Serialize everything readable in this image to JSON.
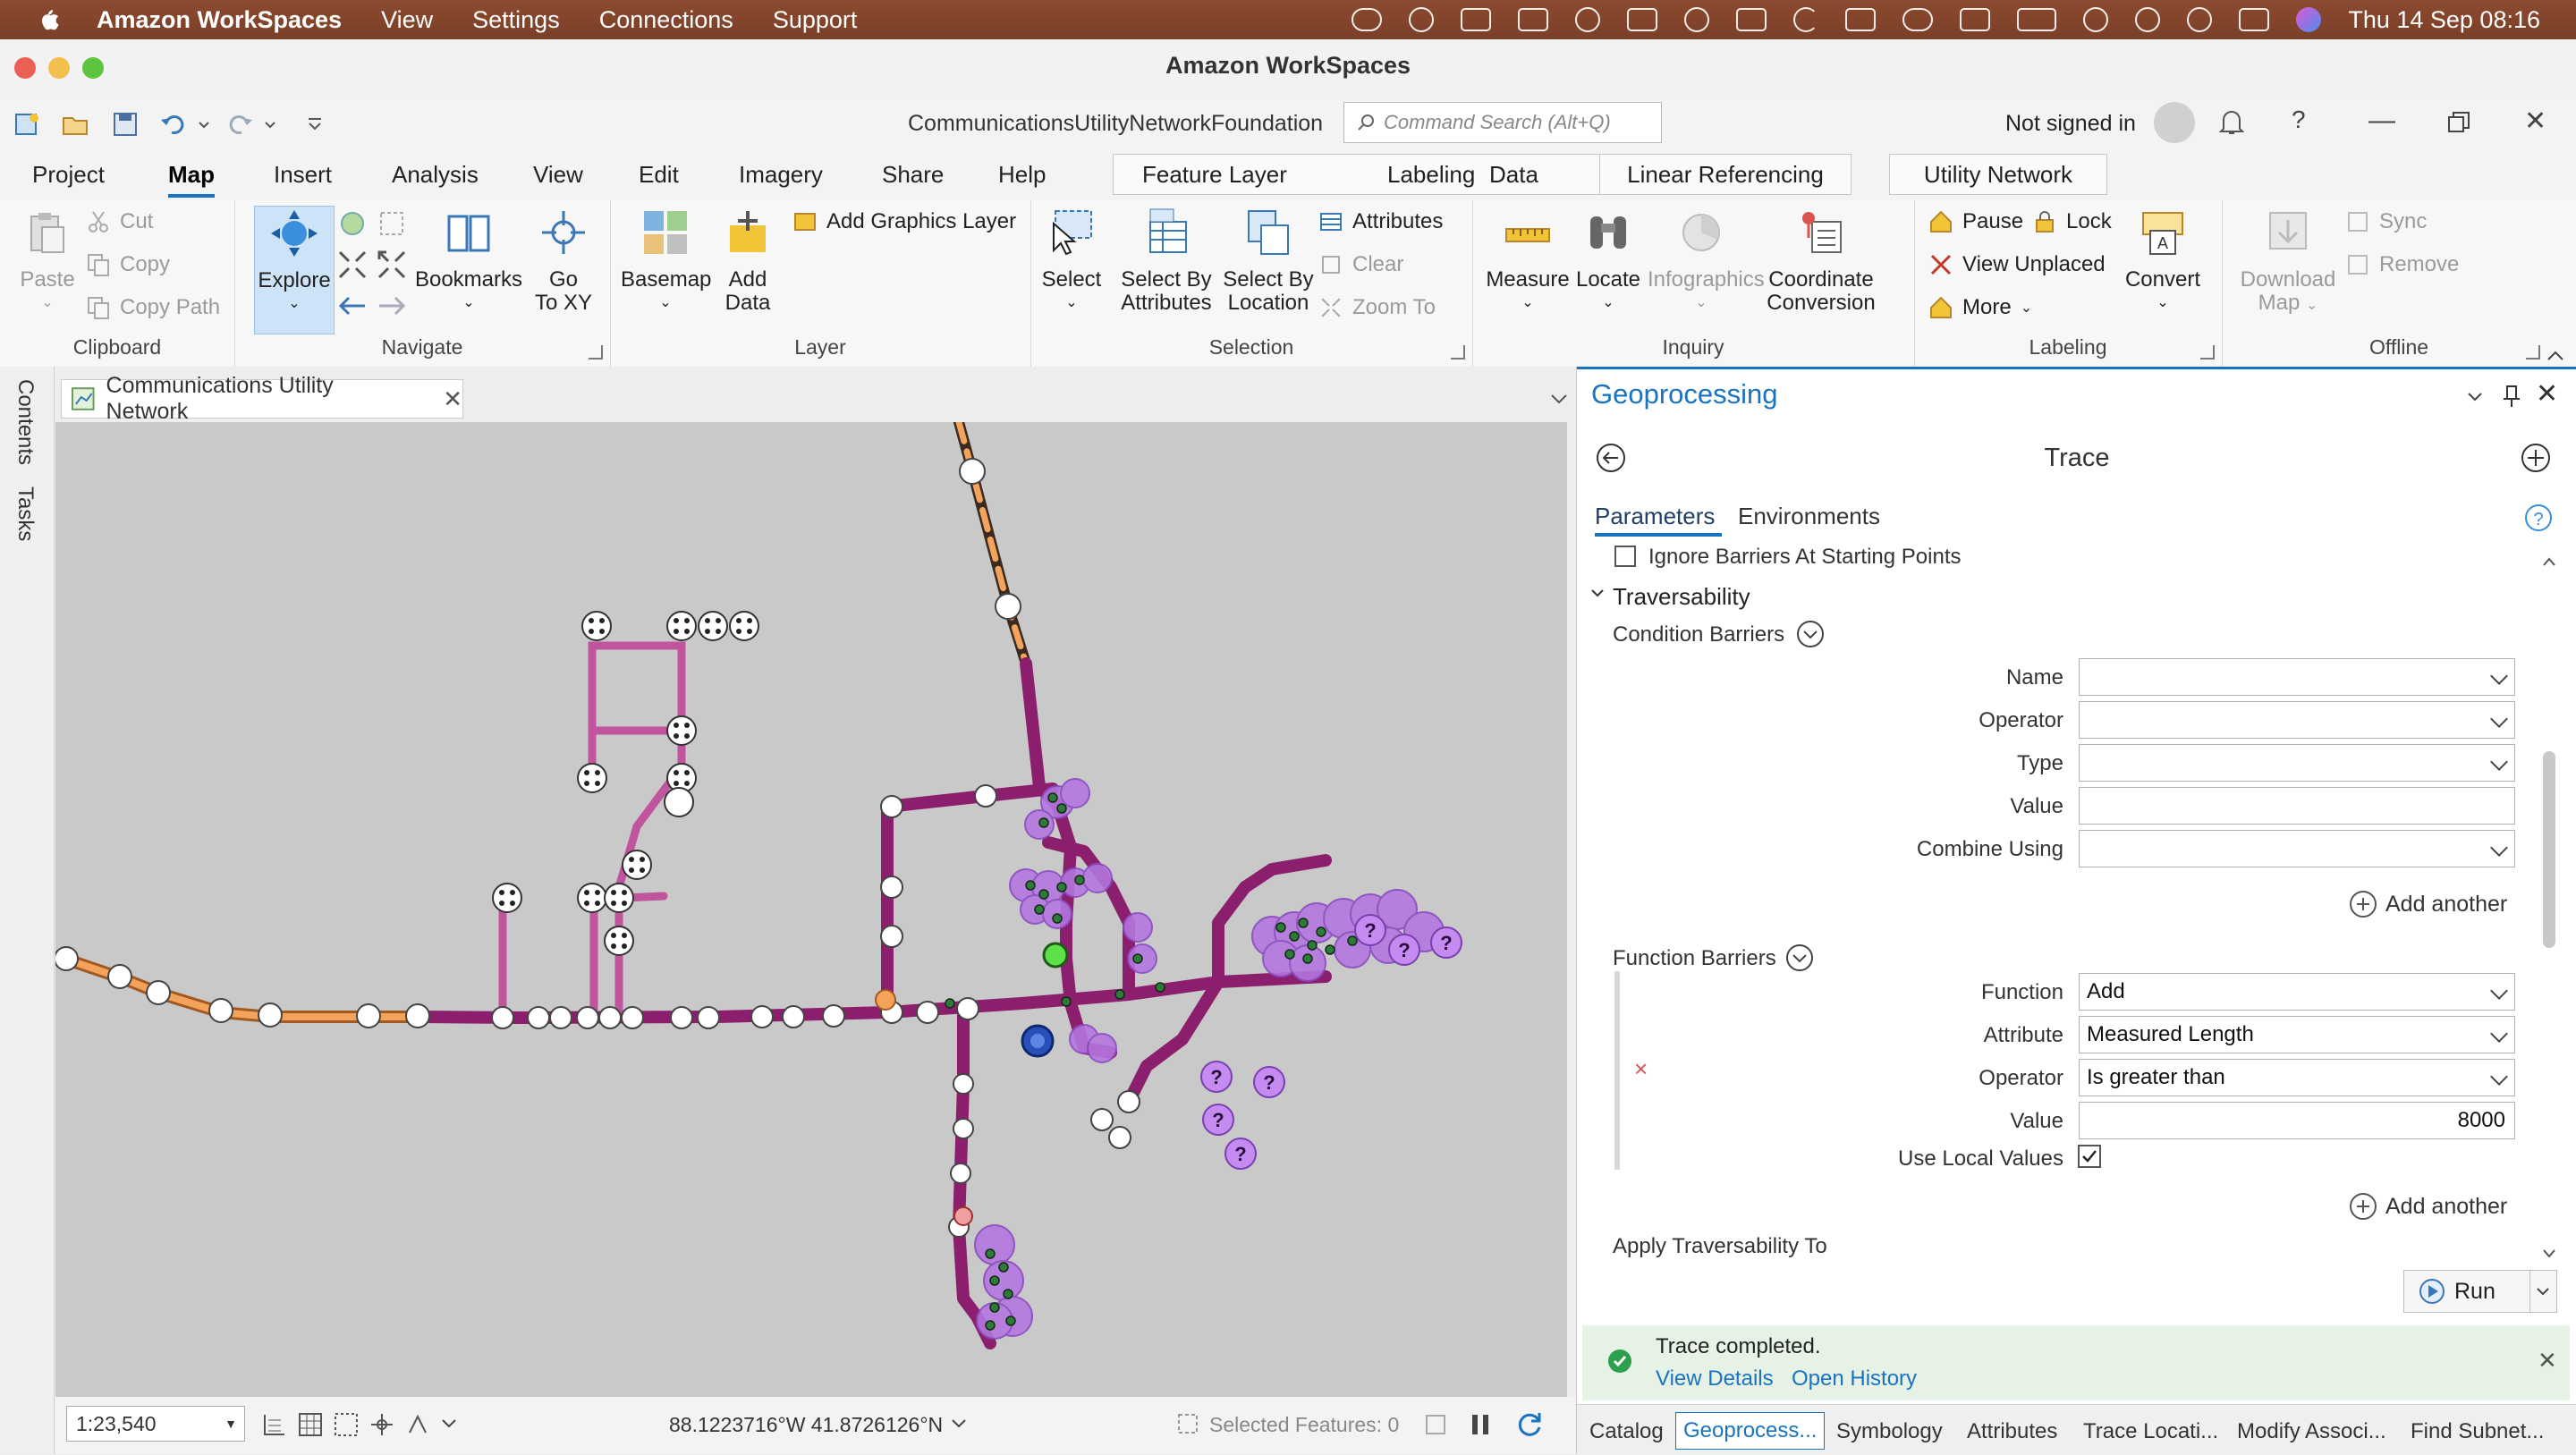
{
  "menubar": {
    "app": "Amazon WorkSpaces",
    "items": [
      "View",
      "Settings",
      "Connections",
      "Support"
    ],
    "datetime": "Thu 14 Sep  08:16"
  },
  "window": {
    "title": "Amazon WorkSpaces"
  },
  "qat": {
    "project": "CommunicationsUtilityNetworkFoundation",
    "search_placeholder": "Command Search (Alt+Q)",
    "signin": "Not signed in"
  },
  "tabs": {
    "main": [
      "Project",
      "Map",
      "Insert",
      "Analysis",
      "View",
      "Edit",
      "Imagery",
      "Share",
      "Help"
    ],
    "active": "Map",
    "context": [
      "Feature Layer",
      "Labeling",
      "Data",
      "Linear Referencing",
      "Utility Network"
    ]
  },
  "ribbon": {
    "clipboard": {
      "label": "Clipboard",
      "paste": "Paste",
      "cut": "Cut",
      "copy": "Copy",
      "copy_path": "Copy Path"
    },
    "navigate": {
      "label": "Navigate",
      "explore": "Explore",
      "bookmarks": "Bookmarks",
      "goto_xy_1": "Go",
      "goto_xy_2": "To XY"
    },
    "layer": {
      "label": "Layer",
      "basemap": "Basemap",
      "add_data_1": "Add",
      "add_data_2": "Data",
      "add_graphics": "Add Graphics Layer"
    },
    "selection": {
      "label": "Selection",
      "select": "Select",
      "sba_1": "Select By",
      "sba_2": "Attributes",
      "sbl_1": "Select By",
      "sbl_2": "Location",
      "attributes": "Attributes",
      "clear": "Clear",
      "zoom_to": "Zoom To"
    },
    "inquiry": {
      "label": "Inquiry",
      "measure": "Measure",
      "locate": "Locate",
      "infographics": "Infographics",
      "coord_1": "Coordinate",
      "coord_2": "Conversion"
    },
    "labeling": {
      "label": "Labeling",
      "pause": "Pause",
      "lock": "Lock",
      "view_unplaced": "View Unplaced",
      "more": "More",
      "convert": "Convert"
    },
    "offline": {
      "label": "Offline",
      "download_1": "Download",
      "download_2": "Map",
      "sync": "Sync",
      "remove": "Remove"
    }
  },
  "leftdock": {
    "contents": "Contents",
    "tasks": "Tasks"
  },
  "map": {
    "tab_title": "Communications Utility Network",
    "scale": "1:23,540",
    "coordinates": "88.1223716°W 41.8726126°N",
    "selected_features": "Selected Features: 0"
  },
  "geoprocessing": {
    "title": "Geoprocessing",
    "tool": "Trace",
    "tab_parameters": "Parameters",
    "tab_environments": "Environments",
    "ignore_barriers": "Ignore Barriers At Starting Points",
    "traversability": "Traversability",
    "condition_barriers": {
      "heading": "Condition Barriers",
      "name_label": "Name",
      "name_value": "",
      "operator_label": "Operator",
      "operator_value": "",
      "type_label": "Type",
      "type_value": "",
      "value_label": "Value",
      "value_value": "",
      "combine_label": "Combine Using",
      "combine_value": ""
    },
    "add_another": "Add another",
    "function_barriers": {
      "heading": "Function Barriers",
      "function_label": "Function",
      "function_value": "Add",
      "attribute_label": "Attribute",
      "attribute_value": "Measured Length",
      "operator_label": "Operator",
      "operator_value": "Is greater than",
      "value_label": "Value",
      "value_value": "8000",
      "use_local_label": "Use Local Values",
      "use_local_checked": true
    },
    "apply_traversability": "Apply Traversability To",
    "run": "Run",
    "status": "Trace completed.",
    "view_details": "View Details",
    "open_history": "Open History",
    "bottom_tabs": [
      "Catalog",
      "Geoprocess...",
      "Symbology",
      "Attributes",
      "Trace Locati...",
      "Modify Associ...",
      "Find Subnet..."
    ],
    "active_bottom_tab": "Geoprocess..."
  },
  "colors": {
    "accent": "#1a73c0",
    "menubar": "#7f422b",
    "network_line": "#8b1f6e",
    "service_line": "#c0549d",
    "feeder_line": "#f2a05a",
    "selection": "#b476e0",
    "success": "#2e9e4f"
  }
}
